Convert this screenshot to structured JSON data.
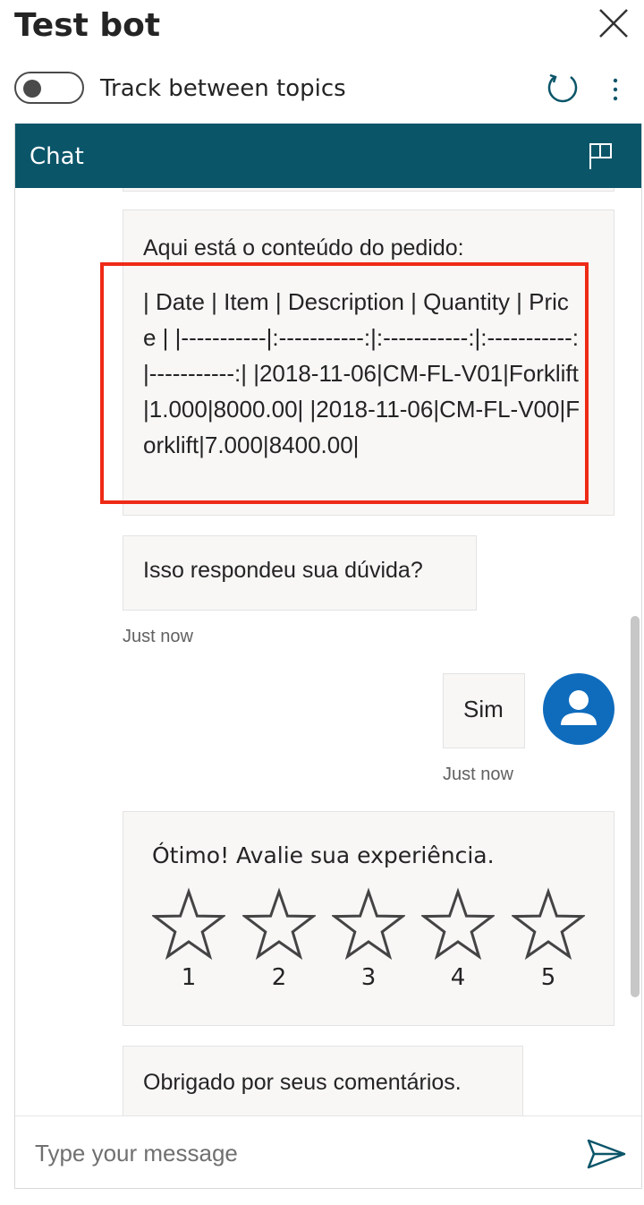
{
  "header": {
    "title": "Test bot",
    "toggle_label": "Track between topics"
  },
  "icons": {
    "close": "close-icon",
    "refresh": "refresh-icon",
    "more": "more-vertical-icon",
    "flag": "flag-icon",
    "avatar": "person-icon",
    "star": "star-outline-icon",
    "send": "send-icon"
  },
  "colors": {
    "header_bg": "#0b5569",
    "highlight_border": "#ee2a16",
    "avatar_bg": "#0f6cbd",
    "send_icon": "#0b5569"
  },
  "chat": {
    "title": "Chat",
    "messages": [
      {
        "from": "bot",
        "intro": "Aqui está o conteúdo do pedido:",
        "text": "| Date | Item | Description | Quantity | Price | |-----------|:-----------:|:-----------:|:-----------:|-----------:| |2018-11-06|CM-FL-V01|Forklift|1.000|8000.00| |2018-11-06|CM-FL-V00|Forklift|7.000|8400.00|"
      },
      {
        "from": "bot",
        "text": "Isso respondeu sua dúvida?",
        "timestamp": "Just now"
      },
      {
        "from": "user",
        "text": "Sim",
        "timestamp": "Just now"
      },
      {
        "from": "bot",
        "text": "Ótimo! Avalie sua experiência.",
        "rating_options": [
          "1",
          "2",
          "3",
          "4",
          "5"
        ]
      },
      {
        "from": "bot",
        "text": "Obrigado por seus comentários."
      }
    ]
  },
  "input": {
    "placeholder": "Type your message"
  }
}
